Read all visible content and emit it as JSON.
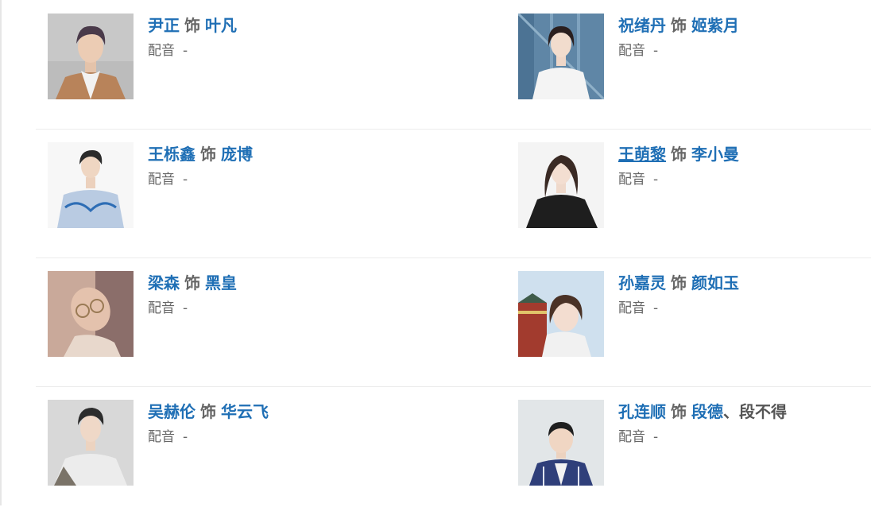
{
  "cast": [
    {
      "left": {
        "actor": "尹正",
        "as": "饰",
        "roles": [
          "叶凡"
        ],
        "dub_label": "配音",
        "dub_value": "-",
        "photo": "portrait-man-camel-coat"
      },
      "right": {
        "actor": "祝绪丹",
        "as": "饰",
        "roles": [
          "姬紫月"
        ],
        "dub_label": "配音",
        "dub_value": "-",
        "photo": "portrait-woman-blue-door"
      }
    },
    {
      "left": {
        "actor": "王栎鑫",
        "as": "饰",
        "roles": [
          "庞博"
        ],
        "dub_label": "配音",
        "dub_value": "-",
        "photo": "portrait-man-blue-sweater"
      },
      "right": {
        "actor": "王萌黎",
        "as": "饰",
        "roles": [
          "李小曼"
        ],
        "dub_label": "配音",
        "dub_value": "-",
        "photo": "portrait-woman-black-jacket"
      }
    },
    {
      "left": {
        "actor": "梁森",
        "as": "饰",
        "roles": [
          "黑皇"
        ],
        "dub_label": "配音",
        "dub_value": "-",
        "photo": "portrait-man-glasses"
      },
      "right": {
        "actor": "孙嘉灵",
        "as": "饰",
        "roles": [
          "颜如玉"
        ],
        "dub_label": "配音",
        "dub_value": "-",
        "photo": "portrait-woman-temple"
      }
    },
    {
      "left": {
        "actor": "吴赫伦",
        "as": "饰",
        "roles": [
          "华云飞"
        ],
        "dub_label": "配音",
        "dub_value": "-",
        "photo": "portrait-man-white-shirt"
      },
      "right": {
        "actor": "孔连顺",
        "as": "饰",
        "roles": [
          "段德",
          "段不得"
        ],
        "role_separator": "、",
        "dub_label": "配音",
        "dub_value": "-",
        "photo": "portrait-man-vest"
      }
    }
  ],
  "colors": {
    "link": "#1f6fb5",
    "muted": "#666666",
    "divider": "#ececec"
  }
}
